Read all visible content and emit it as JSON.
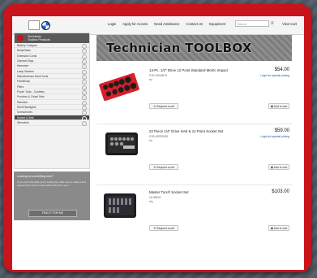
{
  "colors": {
    "frame": "#c8141c",
    "page_bg": "#ffffff",
    "sidebar_active": "#4a4a4a",
    "login_link": "#1a4fa0"
  },
  "header": {
    "nav": [
      "Login",
      "Apply for Access",
      "Need Assistance",
      "Contact Us",
      "Equipment"
    ],
    "search_placeholder": "Search",
    "view_cart": "View Cart"
  },
  "sidebar": {
    "title_line1": "Technician",
    "title_line2": "Toolbox Products",
    "items": [
      "Battery Chargers",
      "Body/Glass",
      "Extension Cords",
      "General Shop",
      "Hammers",
      "Lamp Starters",
      "Miscellaneous Hand Tools",
      "Paint/Body",
      "Pliers",
      "Power Tools - Cordless",
      "Punches & Chisel Sets",
      "Ratchets",
      "Reel/Flashlights",
      "Screwdrivers",
      "Socket & Sets",
      "Wrenches"
    ],
    "active_index": 14
  },
  "promo": {
    "title": "Looking for something else?",
    "body": "If you can't find what you're looking for, click here to make a tool request form and our team will reach out to you!",
    "button": "FIND IT FOR ME"
  },
  "banner": {
    "title": "Technician TOOLBOX"
  },
  "products": [
    {
      "name": "13-Pc. 1/2\" Drive 12 Point Standard Metric Impact",
      "sku": "SYB-SUN3679",
      "unit": "ea",
      "price": "$54.00",
      "login": "Login for special pricing",
      "quote": "Request a call",
      "cart": "Add to cart"
    },
    {
      "name": "22 Piece 1/4\" Drive SAE & 12 Point Socket Set",
      "sku": "SYB-KEP89351",
      "unit": "ea",
      "price": "$59.00",
      "login": "Login for special pricing",
      "quote": "Request a call",
      "cart": "Add to cart"
    },
    {
      "name": "Master Torx® Socket Set",
      "sku": "16-3800A",
      "unit": "ctq",
      "price": "$103.00",
      "login": "",
      "quote": "Request a call",
      "cart": "Add to cart"
    }
  ]
}
